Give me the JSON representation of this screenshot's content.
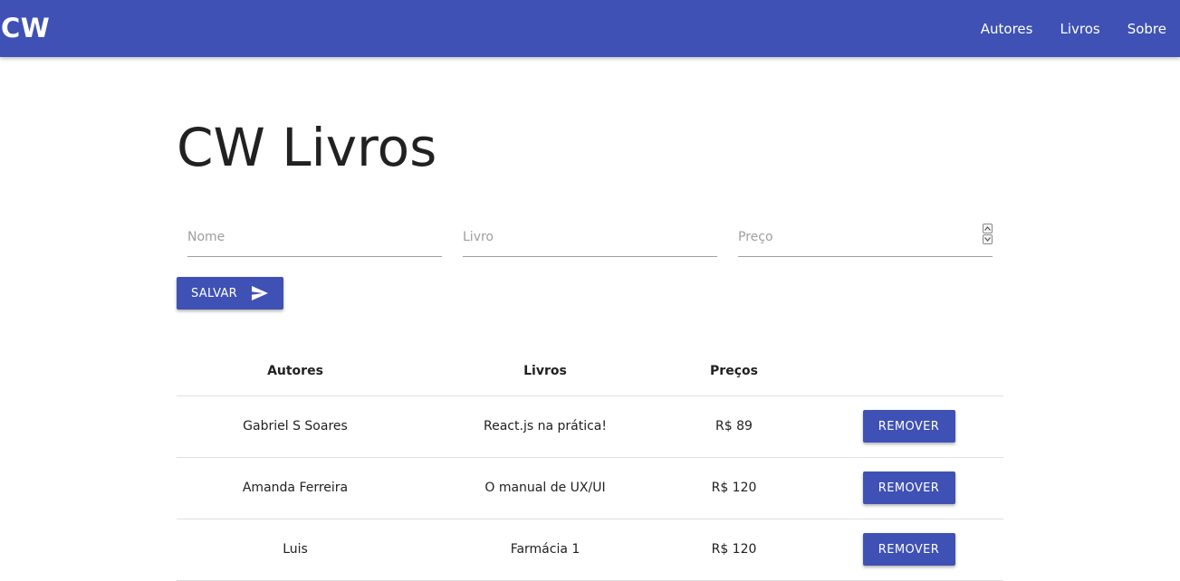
{
  "navbar": {
    "brand": "CW",
    "links": [
      "Autores",
      "Livros",
      "Sobre"
    ],
    "color": "#3f51b5"
  },
  "page_title": "CW Livros",
  "form": {
    "nome_placeholder": "Nome",
    "livro_placeholder": "Livro",
    "preco_placeholder": "Preço",
    "save_label": "SALVAR",
    "save_icon": "send-icon"
  },
  "table": {
    "headers": [
      "Autores",
      "Livros",
      "Preços",
      ""
    ],
    "rows": [
      {
        "autor": "Gabriel S Soares",
        "livro": "React.js na prática!",
        "preco": "R$ 89",
        "action": "REMOVER"
      },
      {
        "autor": "Amanda Ferreira",
        "livro": "O manual de UX/UI",
        "preco": "R$ 120",
        "action": "REMOVER"
      },
      {
        "autor": "Luis",
        "livro": "Farmácia 1",
        "preco": "R$ 120",
        "action": "REMOVER"
      }
    ]
  }
}
